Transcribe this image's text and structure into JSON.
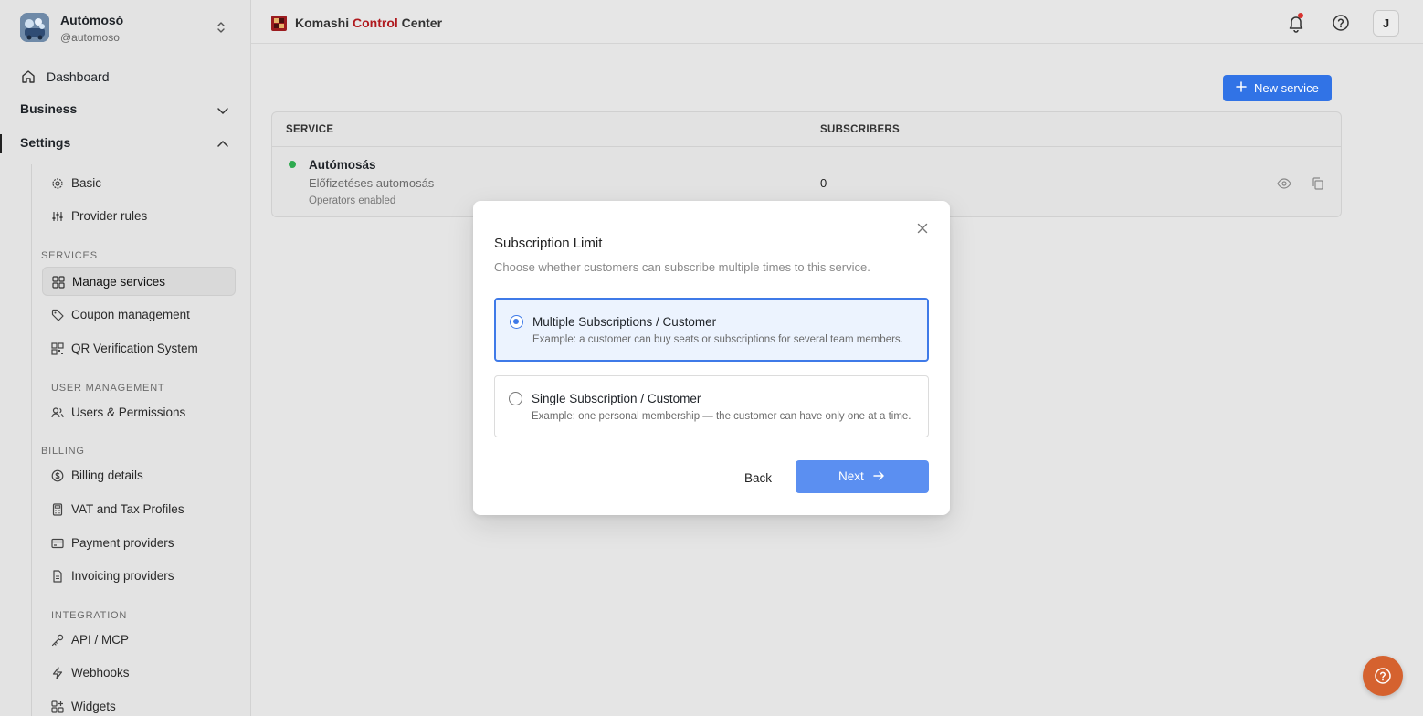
{
  "workspace": {
    "name": "Autómosó",
    "handle": "@automoso"
  },
  "nav": {
    "dashboard": "Dashboard",
    "business": "Business",
    "settings": "Settings",
    "basic": "Basic",
    "provider_rules": "Provider rules",
    "sections": {
      "services": "SERVICES",
      "user_management": "USER MANAGEMENT",
      "billing": "BILLING",
      "integration": "INTEGRATION"
    },
    "services_items": [
      "Manage services",
      "Coupon management",
      "QR Verification System"
    ],
    "user_items": [
      "Users & Permissions"
    ],
    "billing_items": [
      "Billing details",
      "VAT and Tax Profiles",
      "Payment providers",
      "Invoicing providers"
    ],
    "integration_items": [
      "API / MCP",
      "Webhooks",
      "Widgets"
    ]
  },
  "header": {
    "brand_a": "Komashi ",
    "brand_b": "Control",
    "brand_c": " Center",
    "avatar": "J"
  },
  "main": {
    "new_button": "New service",
    "columns": [
      "SERVICE",
      "SUBSCRIBERS"
    ],
    "rows": [
      {
        "name": "Autómosás",
        "description": "Előfizetéses automosás",
        "meta": "Operators enabled",
        "subscribers": "0"
      }
    ]
  },
  "modal": {
    "title": "Subscription Limit",
    "subtitle": "Choose whether customers can subscribe multiple times to this service.",
    "options": [
      {
        "title": "Multiple Subscriptions / Customer",
        "desc": "Example: a customer can buy seats or subscriptions for several team members.",
        "selected": true
      },
      {
        "title": "Single Subscription / Customer",
        "desc": "Example: one personal membership — the customer can have only one at a time.",
        "selected": false
      }
    ],
    "back": "Back",
    "next": "Next"
  },
  "colors": {
    "primary": "#3173e6",
    "brand_red": "#b0191e",
    "status_green": "#2eaa4f",
    "help_orange": "#d5622f"
  }
}
